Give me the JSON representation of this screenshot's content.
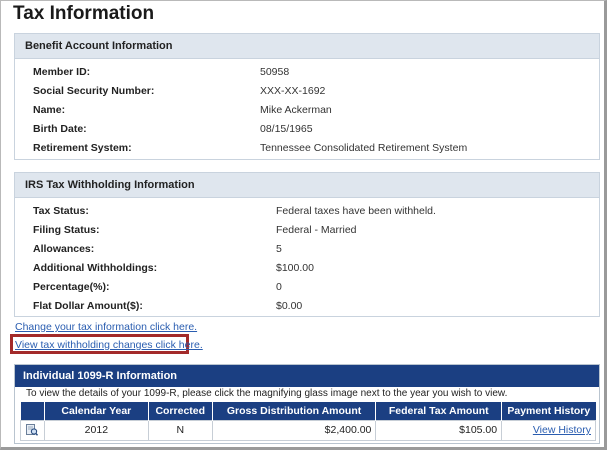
{
  "page": {
    "title": "Tax Information"
  },
  "benefit": {
    "header": "Benefit Account Information",
    "rows": [
      {
        "label": "Member ID:",
        "value": "50958"
      },
      {
        "label": "Social Security Number:",
        "value": "XXX-XX-1692"
      },
      {
        "label": "Name:",
        "value": "Mike Ackerman"
      },
      {
        "label": "Birth Date:",
        "value": "08/15/1965"
      },
      {
        "label": "Retirement System:",
        "value": "Tennessee Consolidated Retirement System"
      }
    ]
  },
  "irs": {
    "header": "IRS Tax Withholding Information",
    "rows": [
      {
        "label": "Tax Status:",
        "value": "Federal taxes have been withheld."
      },
      {
        "label": "Filing Status:",
        "value": "Federal - Married"
      },
      {
        "label": "Allowances:",
        "value": "5"
      },
      {
        "label": "Additional Withholdings:",
        "value": "$100.00"
      },
      {
        "label": "Percentage(%):",
        "value": "0"
      },
      {
        "label": "Flat Dollar Amount($):",
        "value": "$0.00"
      }
    ]
  },
  "links": {
    "change_tax": "Change your tax information click here.",
    "view_changes": "View tax withholding changes click here."
  },
  "form1099": {
    "header": "Individual 1099-R Information",
    "instructions": "To view the details of your 1099-R, please click the magnifying glass image next to the year you wish to view.",
    "columns": [
      "",
      "Calendar Year",
      "Corrected",
      "Gross Distribution Amount",
      "Federal Tax Amount",
      "Payment History"
    ],
    "rows": [
      {
        "year": "2012",
        "corrected": "N",
        "gross": "$2,400.00",
        "federal": "$105.00",
        "history": "View History"
      }
    ]
  },
  "icons": {
    "view": "magnifying-glass-icon"
  },
  "colors": {
    "header_blue": "#1b3f82",
    "section_bg": "#dfe6ee",
    "link": "#2a5db0",
    "highlight": "#a32a2a"
  }
}
